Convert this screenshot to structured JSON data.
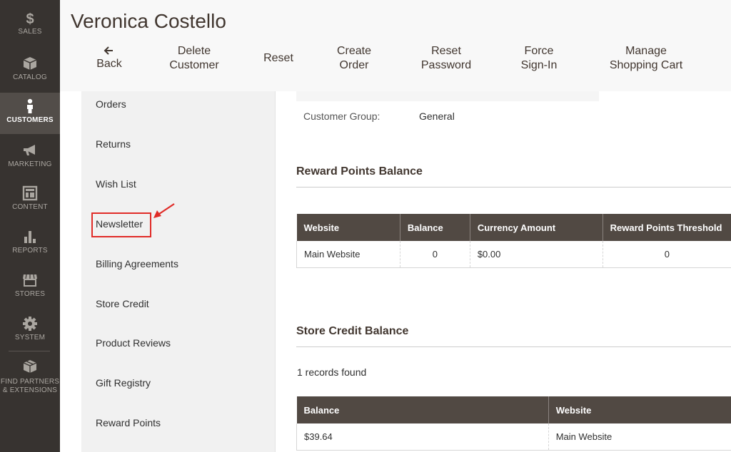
{
  "nav": {
    "items": [
      {
        "label": "SALES",
        "icon": "dollar-icon"
      },
      {
        "label": "CATALOG",
        "icon": "cube-icon"
      },
      {
        "label": "CUSTOMERS",
        "icon": "person-icon"
      },
      {
        "label": "MARKETING",
        "icon": "megaphone-icon"
      },
      {
        "label": "CONTENT",
        "icon": "layout-icon"
      },
      {
        "label": "REPORTS",
        "icon": "bar-chart-icon"
      },
      {
        "label": "STORES",
        "icon": "storefront-icon"
      },
      {
        "label": "SYSTEM",
        "icon": "gear-icon"
      },
      {
        "label_line1": "FIND PARTNERS",
        "label_line2": "& EXTENSIONS",
        "icon": "box-icon"
      }
    ],
    "active": "CUSTOMERS"
  },
  "header": {
    "title": "Veronica Costello",
    "actions": {
      "back": "Back",
      "delete_1": "Delete",
      "delete_2": "Customer",
      "reset": "Reset",
      "create_1": "Create",
      "create_2": "Order",
      "reset_pw_1": "Reset",
      "reset_pw_2": "Password",
      "force_1": "Force",
      "force_2": "Sign-In",
      "manage_1": "Manage",
      "manage_2": "Shopping Cart"
    }
  },
  "tabs": [
    "Orders",
    "Returns",
    "Wish List",
    "Newsletter",
    "Billing Agreements",
    "Store Credit",
    "Product Reviews",
    "Gift Registry",
    "Reward Points"
  ],
  "highlighted_tab": "Newsletter",
  "customer_group": {
    "label": "Customer Group:",
    "value": "General"
  },
  "reward_points": {
    "title": "Reward Points Balance",
    "headers": [
      "Website",
      "Balance",
      "Currency Amount",
      "Reward Points Threshold"
    ],
    "row": [
      "Main Website",
      "0",
      "$0.00",
      "0"
    ]
  },
  "store_credit": {
    "title": "Store Credit Balance",
    "records": "1 records found",
    "headers": [
      "Balance",
      "Website"
    ],
    "row": [
      "$39.64",
      "Main Website"
    ]
  },
  "colors": {
    "nav_bg": "#373330",
    "table_header": "#514943",
    "highlight": "#e02b27"
  }
}
